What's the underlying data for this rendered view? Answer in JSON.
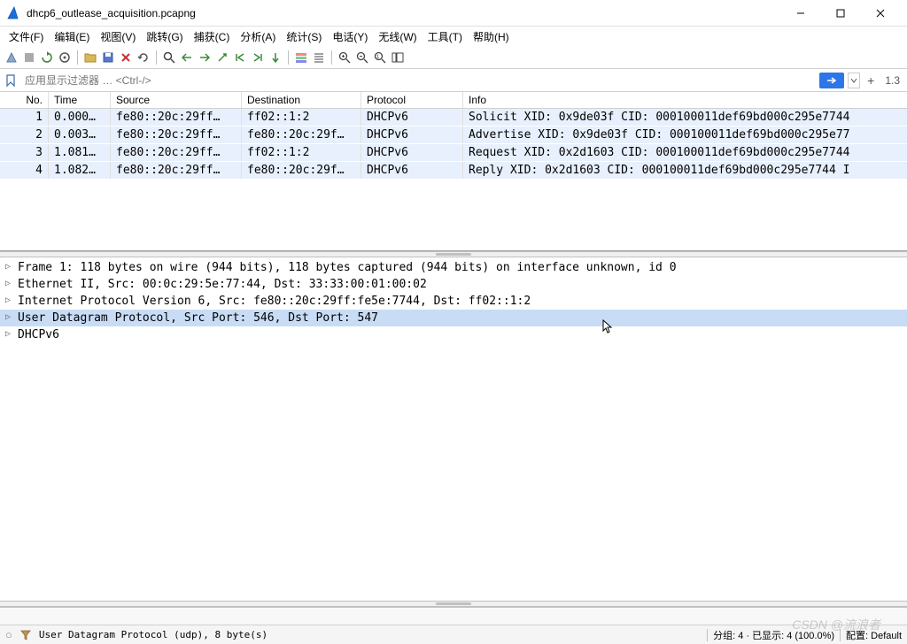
{
  "window": {
    "title": "dhcp6_outlease_acquisition.pcapng"
  },
  "menu": {
    "file": "文件(F)",
    "edit": "编辑(E)",
    "view": "视图(V)",
    "go": "跳转(G)",
    "capture": "捕获(C)",
    "analyze": "分析(A)",
    "stats": "统计(S)",
    "telephony": "电话(Y)",
    "wireless": "无线(W)",
    "tools": "工具(T)",
    "help": "帮助(H)"
  },
  "filter": {
    "placeholder": "应用显示过滤器 … <Ctrl-/>",
    "version": "1.3"
  },
  "columns": {
    "no": "No.",
    "time": "Time",
    "src": "Source",
    "dst": "Destination",
    "proto": "Protocol",
    "info": "Info"
  },
  "packets": [
    {
      "no": "1",
      "time": "0.000…",
      "src": "fe80::20c:29ff…",
      "dst": "ff02::1:2",
      "proto": "DHCPv6",
      "info": "Solicit XID: 0x9de03f CID: 000100011def69bd000c295e7744"
    },
    {
      "no": "2",
      "time": "0.003…",
      "src": "fe80::20c:29ff…",
      "dst": "fe80::20c:29f…",
      "proto": "DHCPv6",
      "info": "Advertise XID: 0x9de03f CID: 000100011def69bd000c295e77"
    },
    {
      "no": "3",
      "time": "1.081…",
      "src": "fe80::20c:29ff…",
      "dst": "ff02::1:2",
      "proto": "DHCPv6",
      "info": "Request XID: 0x2d1603 CID: 000100011def69bd000c295e7744"
    },
    {
      "no": "4",
      "time": "1.082…",
      "src": "fe80::20c:29ff…",
      "dst": "fe80::20c:29f…",
      "proto": "DHCPv6",
      "info": "Reply XID: 0x2d1603 CID: 000100011def69bd000c295e7744 I"
    }
  ],
  "details": {
    "frame": "Frame 1: 118 bytes on wire (944 bits), 118 bytes captured (944 bits) on interface unknown, id 0",
    "eth": "Ethernet II, Src: 00:0c:29:5e:77:44, Dst: 33:33:00:01:00:02",
    "ipv6": "Internet Protocol Version 6, Src: fe80::20c:29ff:fe5e:7744, Dst: ff02::1:2",
    "udp": "User Datagram Protocol, Src Port: 546, Dst Port: 547",
    "dhcpv6": "DHCPv6"
  },
  "status": {
    "expert_icon": "○",
    "field": "User Datagram Protocol (udp), 8 byte(s)",
    "packets": "分组: 4 · 已显示: 4 (100.0%)",
    "profile": "配置: Default"
  },
  "watermark": "CSDN @流浪者"
}
